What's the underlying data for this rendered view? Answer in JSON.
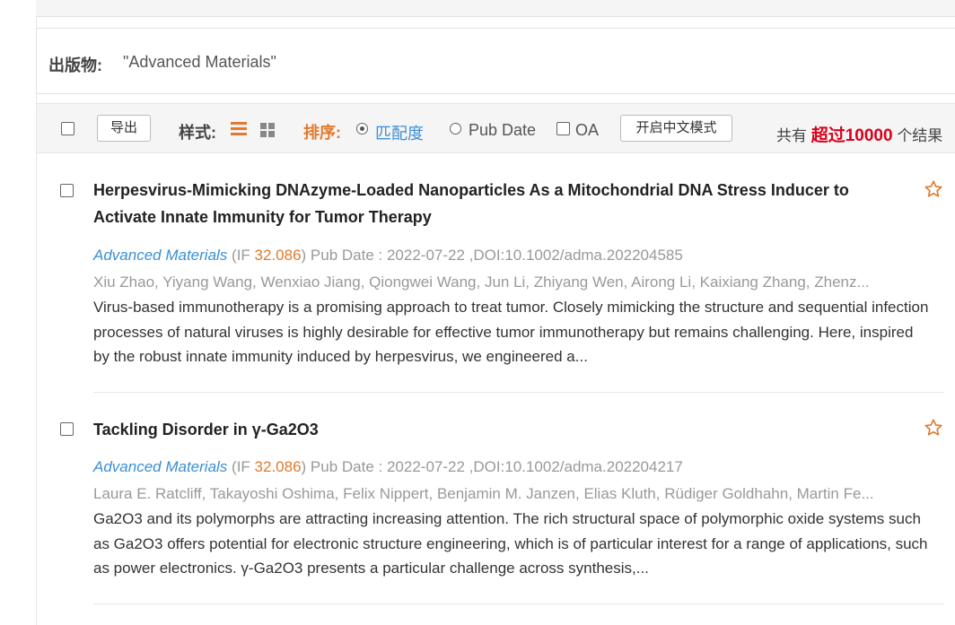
{
  "publication_filter": {
    "label": "出版物:",
    "value": "\"Advanced Materials\""
  },
  "toolbar": {
    "export_label": "导出",
    "style_label": "样式:",
    "sort_label": "排序:",
    "sort_options": [
      {
        "label": "匹配度",
        "selected": true
      },
      {
        "label": "Pub Date",
        "selected": false
      }
    ],
    "oa_label": "OA",
    "chinese_mode_label": "开启中文模式",
    "total_prefix": "共有",
    "total_highlight": "超过10000",
    "total_suffix": "个结果",
    "accent_color": "#e07a2e",
    "highlight_color": "#d9001b"
  },
  "results": [
    {
      "title": "Herpesvirus-Mimicking DNAzyme-Loaded Nanoparticles As a Mitochondrial DNA Stress Inducer to Activate Innate Immunity for Tumor Therapy",
      "journal": "Advanced Materials",
      "if_prefix": " (IF ",
      "if_value": "32.086",
      "meta_rest": ") Pub Date : 2022-07-22 ,DOI:10.1002/adma.202204585",
      "authors": "Xiu Zhao, Yiyang Wang, Wenxiao Jiang, Qiongwei Wang, Jun Li, Zhiyang Wen, Airong Li, Kaixiang Zhang, Zhenz...",
      "abstract": "Virus-based immunotherapy is a promising approach to treat tumor. Closely mimicking the structure and sequential infection processes of natural viruses is highly desirable for effective tumor immunotherapy but remains challenging. Here, inspired by the robust innate immunity induced by herpesvirus, we engineered a..."
    },
    {
      "title": "Tackling Disorder in γ-Ga2O3",
      "journal": "Advanced Materials",
      "if_prefix": " (IF ",
      "if_value": "32.086",
      "meta_rest": ") Pub Date : 2022-07-22 ,DOI:10.1002/adma.202204217",
      "authors": "Laura E. Ratcliff, Takayoshi Oshima, Felix Nippert, Benjamin M. Janzen, Elias Kluth, Rüdiger Goldhahn, Martin Fe...",
      "abstract": "Ga2O3 and its polymorphs are attracting increasing attention. The rich structural space of polymorphic oxide systems such as Ga2O3 offers potential for electronic structure engineering, which is of particular interest for a range of applications, such as power electronics. γ-Ga2O3 presents a particular challenge across synthesis,..."
    }
  ]
}
